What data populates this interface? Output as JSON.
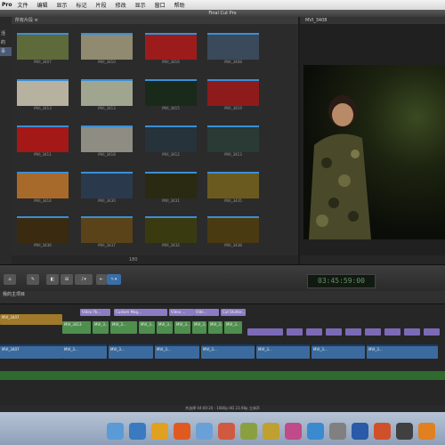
{
  "menubar": {
    "app": "Pro",
    "items": [
      "文件",
      "编辑",
      "显示",
      "标记",
      "片段",
      "修改",
      "显示",
      "窗口",
      "帮助"
    ]
  },
  "window": {
    "title": "Final Cut Pro"
  },
  "sidebar": {
    "items": [
      "活",
      "的",
      "事",
      "",
      "",
      "",
      "",
      ""
    ],
    "selected_index": 2
  },
  "browser": {
    "header": "所有片段 ≡",
    "clips": [
      {
        "name": "MVI_3407",
        "color": "#5e6a3a"
      },
      {
        "name": "MVI_3410",
        "color": "#8f8a70"
      },
      {
        "name": "MVI_3416",
        "color": "#9c1c1c"
      },
      {
        "name": "MVI_3408",
        "color": "#3a4a5a"
      },
      {
        "name": "MVI_3413",
        "color": "#b7b1a0"
      },
      {
        "name": "MVI_3413",
        "color": "#9fa58f"
      },
      {
        "name": "MVI_3415",
        "color": "#1a2a1a"
      },
      {
        "name": "MVI_3419",
        "color": "#8e1b1b"
      },
      {
        "name": "MVI_3411",
        "color": "#a51818"
      },
      {
        "name": "MVI_3418",
        "color": "#8d8d84"
      },
      {
        "name": "MVI_3412",
        "color": "#26333a"
      },
      {
        "name": "MVI_3413",
        "color": "#2a3a34"
      },
      {
        "name": "MVI_3414",
        "color": "#a86a2a"
      },
      {
        "name": "MVI_3430",
        "color": "#2a3a4c"
      },
      {
        "name": "MVI_3431",
        "color": "#2a2a12"
      },
      {
        "name": "MVI_3435",
        "color": "#6a5a20"
      },
      {
        "name": "MVI_3436",
        "color": "#3a2a10"
      },
      {
        "name": "MVI_3437",
        "color": "#5a4318"
      },
      {
        "name": "MVI_3432",
        "color": "#3a3a10"
      },
      {
        "name": "MVI_3438",
        "color": "#4a3a12"
      }
    ],
    "footer": "180"
  },
  "viewer": {
    "clip": "MVI_3408",
    "timecode": "03:45:59:00"
  },
  "toolbar": {
    "buttons": [
      "⌂",
      "✎",
      "◧",
      "⊞",
      "♪▾",
      "⇤",
      "↖▾"
    ]
  },
  "timeline": {
    "header": "我的主项目",
    "title_clips": [
      {
        "label": "Video Yb..."
      },
      {
        "label": "Custom Mag..."
      },
      {
        "label": "Video ..."
      },
      {
        "label": "Vide..."
      },
      {
        "label": "Cut Stutter..."
      }
    ],
    "connected_clips": [
      {
        "label": "MVI_3413"
      },
      {
        "label": "MVI_3..."
      },
      {
        "label": "MVI_3..."
      },
      {
        "label": "MVI_3..."
      },
      {
        "label": "MVI_3..."
      },
      {
        "label": "MVI_3..."
      },
      {
        "label": "MVI_3..."
      },
      {
        "label": "MVI_3..."
      },
      {
        "label": "MVI_3..."
      }
    ],
    "primary_clips": [
      {
        "label": "MVI_3407"
      },
      {
        "label": "MVI_3..."
      },
      {
        "label": "MVI_3..."
      },
      {
        "label": "MVI_3..."
      },
      {
        "label": "MVI_3..."
      },
      {
        "label": "MVI_3..."
      },
      {
        "label": "MVI_3..."
      },
      {
        "label": "MVI_3..."
      }
    ]
  },
  "status": "共选择 04:00:20 · 1080p HD 23.98p 立体声",
  "dock": {
    "icons": [
      "finder",
      "safari",
      "chrome",
      "firefox",
      "mail",
      "photos",
      "preview",
      "tools",
      "itunes",
      "appstore",
      "prefs",
      "word",
      "powerpoint",
      "fcp",
      "other"
    ]
  }
}
